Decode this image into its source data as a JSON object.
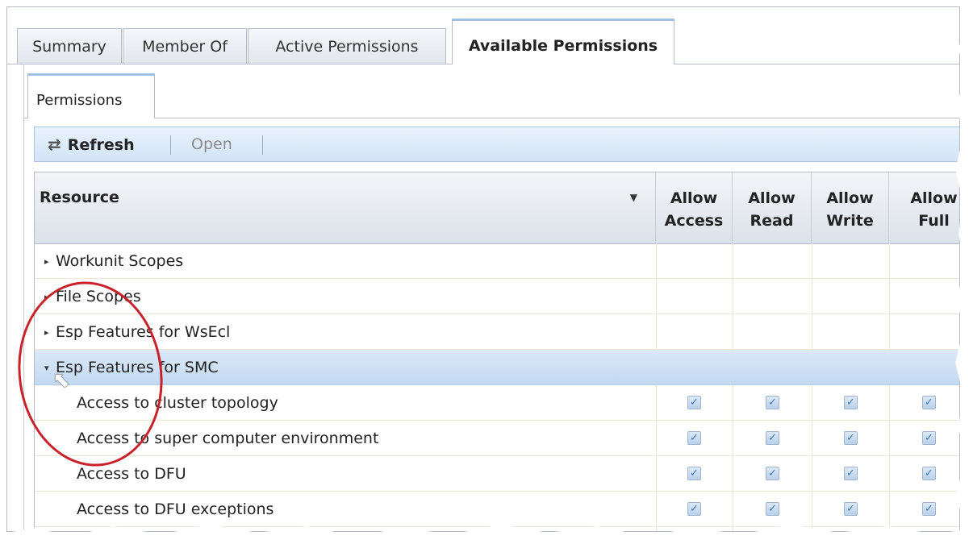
{
  "outer_tabs": [
    "Summary",
    "Member Of",
    "Active Permissions",
    "Available Permissions"
  ],
  "inner_tab": "Permissions",
  "toolbar": {
    "refresh_label": "Refresh",
    "open_label": "Open"
  },
  "grid": {
    "columns": {
      "resource": "Resource",
      "allow_access": [
        "Allow",
        "Access"
      ],
      "allow_read": [
        "Allow",
        "Read"
      ],
      "allow_write": [
        "Allow",
        "Write"
      ],
      "allow_full": [
        "Allow",
        "Full"
      ]
    },
    "rows": [
      {
        "label": "Workunit Scopes",
        "type": "group",
        "expanded": false
      },
      {
        "label": "File Scopes",
        "type": "group",
        "expanded": false
      },
      {
        "label": "Esp Features for WsEcl",
        "type": "group",
        "expanded": false
      },
      {
        "label": "Esp Features for SMC",
        "type": "group",
        "expanded": true,
        "selected": true
      },
      {
        "label": "Access to cluster topology",
        "type": "item",
        "access": true,
        "read": true,
        "write": true,
        "full": true
      },
      {
        "label": "Access to super computer environment",
        "type": "item",
        "access": true,
        "read": true,
        "write": true,
        "full": true
      },
      {
        "label": "Access to DFU",
        "type": "item",
        "access": true,
        "read": true,
        "write": true,
        "full": true
      },
      {
        "label": "Access to DFU exceptions",
        "type": "item",
        "access": true,
        "read": true,
        "write": true,
        "full": true
      }
    ]
  },
  "icons": {
    "refresh": "refresh-icon",
    "sort": "sort-arrow-icon",
    "collapsed": "triangle-right-icon",
    "expanded": "triangle-down-icon",
    "cursor": "mouse-pointer-icon"
  },
  "colors": {
    "annotation": "#c8232b",
    "selected_row": "#c3d9f1",
    "toolbar": "#d3e4f6"
  }
}
